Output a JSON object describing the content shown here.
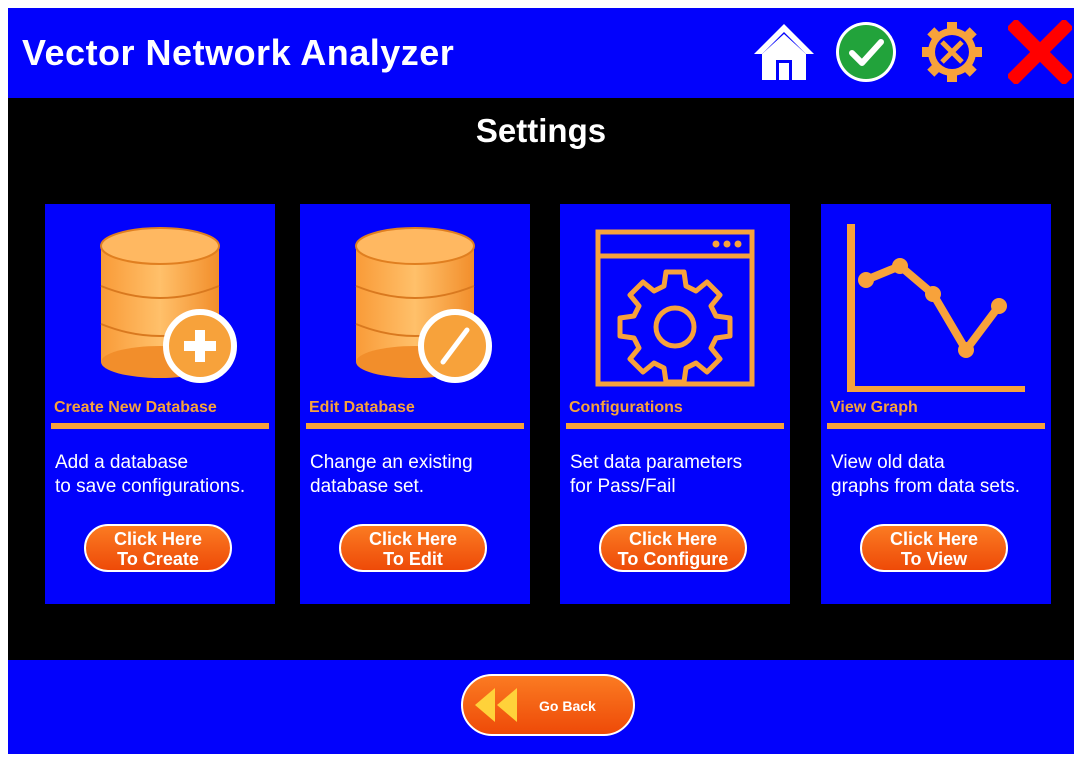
{
  "app": {
    "title": "Vector Network Analyzer"
  },
  "header_icons": [
    {
      "icon": "home-icon"
    },
    {
      "icon": "check-icon",
      "color": "#22a33b"
    },
    {
      "icon": "tools-gear-icon",
      "color": "#f7a23b"
    },
    {
      "icon": "close-icon",
      "color": "#ff0000"
    }
  ],
  "page": {
    "title": "Settings"
  },
  "colors": {
    "panel_blue": "#0202fc",
    "accent_orange": "#f7a23b",
    "button_orange": "#f4601a",
    "background": "#000000"
  },
  "cards": [
    {
      "icon": "database-add-icon",
      "title": "Create New Database",
      "desc": [
        "Add a database",
        "to save configurations."
      ],
      "button": [
        "Click Here",
        "To Create"
      ]
    },
    {
      "icon": "database-edit-icon",
      "title": "Edit Database",
      "desc": [
        "Change an existing",
        "database set."
      ],
      "button": [
        "Click Here",
        "To Edit"
      ]
    },
    {
      "icon": "configuration-window-gear-icon",
      "title": "Configurations",
      "desc": [
        "Set data parameters",
        "for Pass/Fail"
      ],
      "button": [
        "Click Here",
        "To Configure"
      ]
    },
    {
      "icon": "line-graph-icon",
      "title": "View Graph",
      "desc": [
        "View old data",
        "graphs from data sets."
      ],
      "button": [
        "Click Here",
        "To View"
      ]
    }
  ],
  "footer": {
    "back_label": "Go Back",
    "back_icon": "rewind-arrows-icon"
  }
}
